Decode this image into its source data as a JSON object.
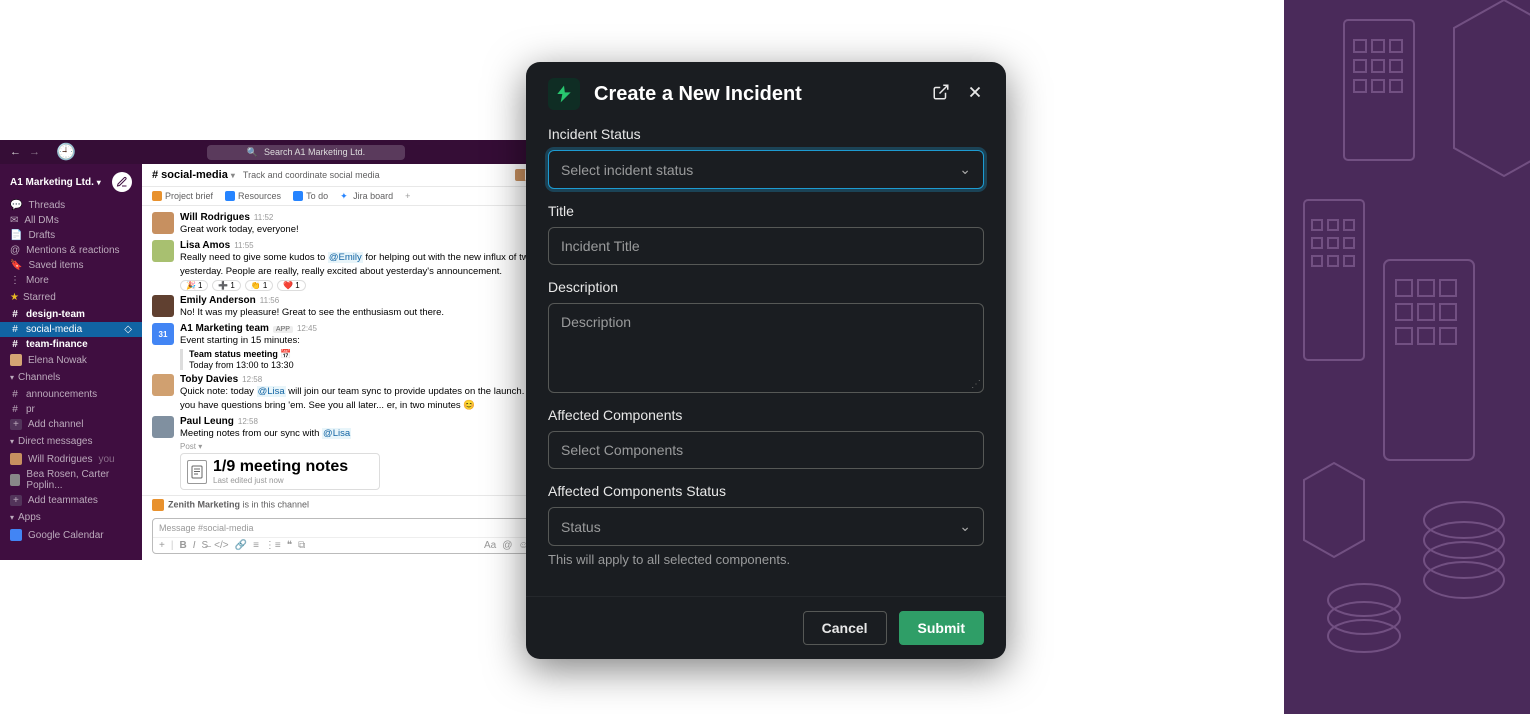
{
  "slack": {
    "workspace_name": "A1 Marketing Ltd.",
    "search_placeholder": "Search A1 Marketing Ltd.",
    "sidebar": {
      "threads": "Threads",
      "all_dms": "All DMs",
      "drafts": "Drafts",
      "mentions": "Mentions & reactions",
      "saved": "Saved items",
      "more": "More",
      "starred_header": "Starred",
      "starred": [
        "design-team",
        "social-media",
        "team-finance"
      ],
      "starred_person": "Elena Nowak",
      "channels_header": "Channels",
      "channels": [
        "announcements",
        "pr"
      ],
      "add_channel": "Add channel",
      "dms_header": "Direct messages",
      "dm1": {
        "name": "Will Rodrigues",
        "suffix": "you"
      },
      "dm2": "Bea Rosen, Carter Poplin...",
      "add_teammates": "Add teammates",
      "apps_header": "Apps",
      "app1": "Google Calendar"
    },
    "channel": {
      "name": "# social-media",
      "desc": "Track and coordinate social media",
      "pins": [
        "Project brief",
        "Resources",
        "To do",
        "Jira board"
      ],
      "banner": {
        "who": "Zenith Marketing",
        "text": " is in this channel"
      },
      "composer_placeholder": "Message #social-media"
    },
    "messages": [
      {
        "author": "Will Rodrigues",
        "time": "11:52",
        "avatar": "#c79060",
        "text": "Great work today, everyone!"
      },
      {
        "author": "Lisa Amos",
        "time": "11:55",
        "avatar": "#a8c070",
        "text_pre": "Really need to give some kudos to ",
        "mention": "@Emily",
        "text_post": " for helping out with the new influx of tweets yesterday. People are really, really excited about yesterday's announcement.",
        "reactions": [
          {
            "e": "🎉",
            "c": "1"
          },
          {
            "e": "➕",
            "c": "1"
          },
          {
            "e": "👏",
            "c": "1"
          },
          {
            "e": "❤️",
            "c": "1"
          }
        ]
      },
      {
        "author": "Emily Anderson",
        "time": "11:56",
        "avatar": "#604030",
        "text": "No! It was my pleasure! Great to see the enthusiasm out there."
      },
      {
        "author": "A1 Marketing team",
        "time": "12:45",
        "avatar": "#4285f4",
        "app": "APP",
        "text": "Event starting in 15 minutes:",
        "event_title": "Team status meeting",
        "event_emoji": "📅",
        "event_time": "Today from 13:00 to 13:30"
      },
      {
        "author": "Toby Davies",
        "time": "12:58",
        "avatar": "#d0a070",
        "text_pre": "Quick note: today ",
        "mention": "@Lisa",
        "text_post": " will join our team sync to provide updates on the launch. If you have questions bring 'em. See you all later... er, in two minutes 😊"
      },
      {
        "author": "Paul Leung",
        "time": "12:58",
        "avatar": "#8090a0",
        "text_pre": "Meeting notes from our sync with ",
        "mention": "@Lisa",
        "text_post": "",
        "post_label": "Post",
        "doc_title": "1/9 meeting notes",
        "doc_sub": "Last edited just now"
      }
    ]
  },
  "modal": {
    "title": "Create a New Incident",
    "fields": {
      "status_label": "Incident Status",
      "status_placeholder": "Select incident status",
      "title_label": "Title",
      "title_placeholder": "Incident Title",
      "desc_label": "Description",
      "desc_placeholder": "Description",
      "components_label": "Affected Components",
      "components_placeholder": "Select Components",
      "comp_status_label": "Affected Components Status",
      "comp_status_placeholder": "Status",
      "comp_status_hint": "This will apply to all selected components."
    },
    "buttons": {
      "cancel": "Cancel",
      "submit": "Submit"
    }
  }
}
